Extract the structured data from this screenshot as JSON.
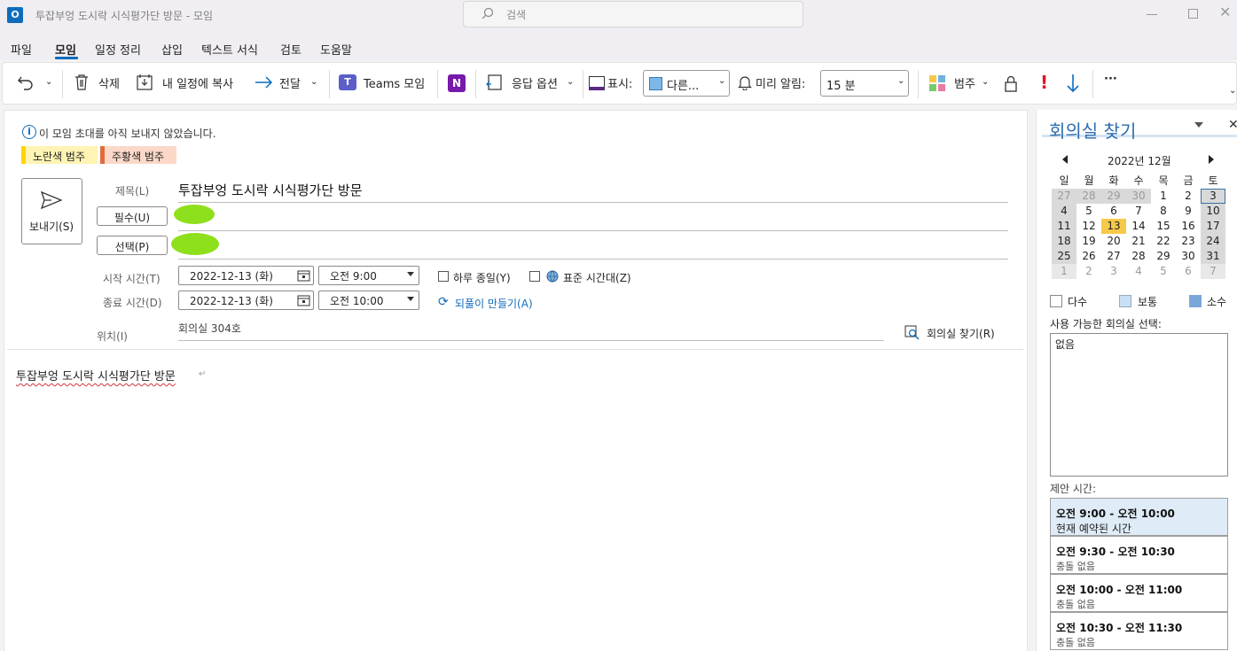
{
  "window": {
    "title": "투잡부엉 도시락 시식평가단 방문  -  모임",
    "search_placeholder": "검색",
    "app_icon": "outlook-icon"
  },
  "menu": [
    "파일",
    "모임",
    "일정 정리",
    "삽입",
    "텍스트 서식",
    "검토",
    "도움말"
  ],
  "ribbon": {
    "delete": "삭제",
    "copy_to_calendar": "내 일정에 복사",
    "forward": "전달",
    "teams": "Teams 모임",
    "response_options": "응답 옵션",
    "show_as_label": "표시:",
    "show_as_value": "다른...",
    "reminder_label": "미리 알림:",
    "reminder_value": "15 분",
    "categorize": "범주",
    "more": "···"
  },
  "info": {
    "message": "이 모임 초대를 아직 보내지 않았습니다.",
    "categories": [
      "노란색 범주",
      "주황색 범주"
    ],
    "category_colors": [
      "#fff4b3",
      "#fbd8c8"
    ],
    "category_accents": [
      "#ffd400",
      "#e06c3c"
    ]
  },
  "form": {
    "send": "보내기(S)",
    "subject_label": "제목(L)",
    "subject": "투잡부엉 도시락 시식평가단 방문",
    "required": "필수(U)",
    "optional": "선택(P)",
    "start_label": "시작 시간(T)",
    "start_date": "2022-12-13 (화)",
    "start_time": "오전 9:00",
    "end_label": "종료 시간(D)",
    "end_date": "2022-12-13 (화)",
    "end_time": "오전 10:00",
    "all_day": "하루 종일(Y)",
    "time_zone": "표준 시간대(Z)",
    "recurrence": "되풀이 만들기(A)",
    "location_label": "위치(I)",
    "location": "회의실 304호",
    "room_finder": "회의실 찾기(R)",
    "body": "투잡부엉 도시락 시식평가단 방문"
  },
  "side": {
    "title": "회의실 찾기",
    "month": "2022년 12월",
    "weekdays": [
      "일",
      "월",
      "화",
      "수",
      "목",
      "금",
      "토"
    ],
    "weeks": [
      [
        "27",
        "28",
        "29",
        "30",
        "1",
        "2",
        "3"
      ],
      [
        "4",
        "5",
        "6",
        "7",
        "8",
        "9",
        "10"
      ],
      [
        "11",
        "12",
        "13",
        "14",
        "15",
        "16",
        "17"
      ],
      [
        "18",
        "19",
        "20",
        "21",
        "22",
        "23",
        "24"
      ],
      [
        "25",
        "26",
        "27",
        "28",
        "29",
        "30",
        "31"
      ],
      [
        "1",
        "2",
        "3",
        "4",
        "5",
        "6",
        "7"
      ]
    ],
    "legend": [
      "다수",
      "보통",
      "소수"
    ],
    "room_label": "사용 가능한 회의실 선택:",
    "room_value": "없음",
    "suggest_label": "제안 시간:",
    "slots": [
      {
        "time": "오전 9:00 - 오전 10:00",
        "status": "현재 예약된 시간"
      },
      {
        "time": "오전 9:30 - 오전 10:30",
        "status": "충돌 없음"
      },
      {
        "time": "오전 10:00 - 오전 11:00",
        "status": "충돌 없음"
      },
      {
        "time": "오전 10:30 - 오전 11:30",
        "status": "충돌 없음"
      }
    ]
  },
  "colors": {
    "accent": "#0f6cbd",
    "today": "#f7c948",
    "selected_border": "#3a6ea5",
    "redacted": "#8ee01c",
    "importance_high": "#e81123",
    "side_title": "#2b6cb0"
  }
}
